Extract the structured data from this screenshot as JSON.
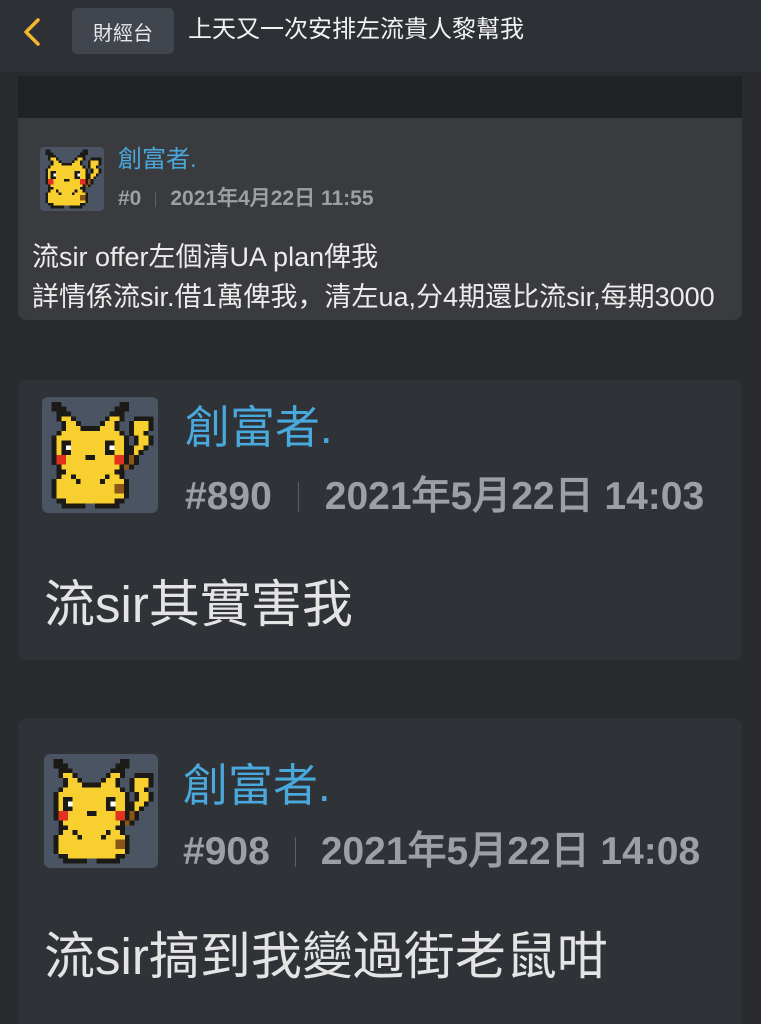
{
  "header": {
    "back_icon": "chevron-left-icon",
    "category": "財經台",
    "title": "上天又一次安排左流貴人黎幫我"
  },
  "quote": {
    "avatar_icon": "pikachu-avatar-icon",
    "author": "創富者.",
    "post_number": "#0",
    "timestamp": "2021年4月22日 11:55",
    "lines": [
      "流sir offer左個清UA plan俾我",
      "詳情係流sir.借1萬俾我，清左ua,分4期還比流sir,每期3000"
    ]
  },
  "posts": [
    {
      "avatar_icon": "pikachu-avatar-icon",
      "author": "創富者.",
      "post_number": "#890",
      "timestamp": "2021年5月22日 14:03",
      "content": "流sir其實害我"
    },
    {
      "avatar_icon": "pikachu-avatar-icon",
      "author": "創富者.",
      "post_number": "#908",
      "timestamp": "2021年5月22日 14:08",
      "content": "流sir搞到我變過街老鼠咁"
    }
  ],
  "colors": {
    "accent": "#f5b62f",
    "username": "#4aa9dc",
    "page_background": "#292b2f",
    "card_background": "#2f3237",
    "quote_background": "#3a3b3e"
  }
}
